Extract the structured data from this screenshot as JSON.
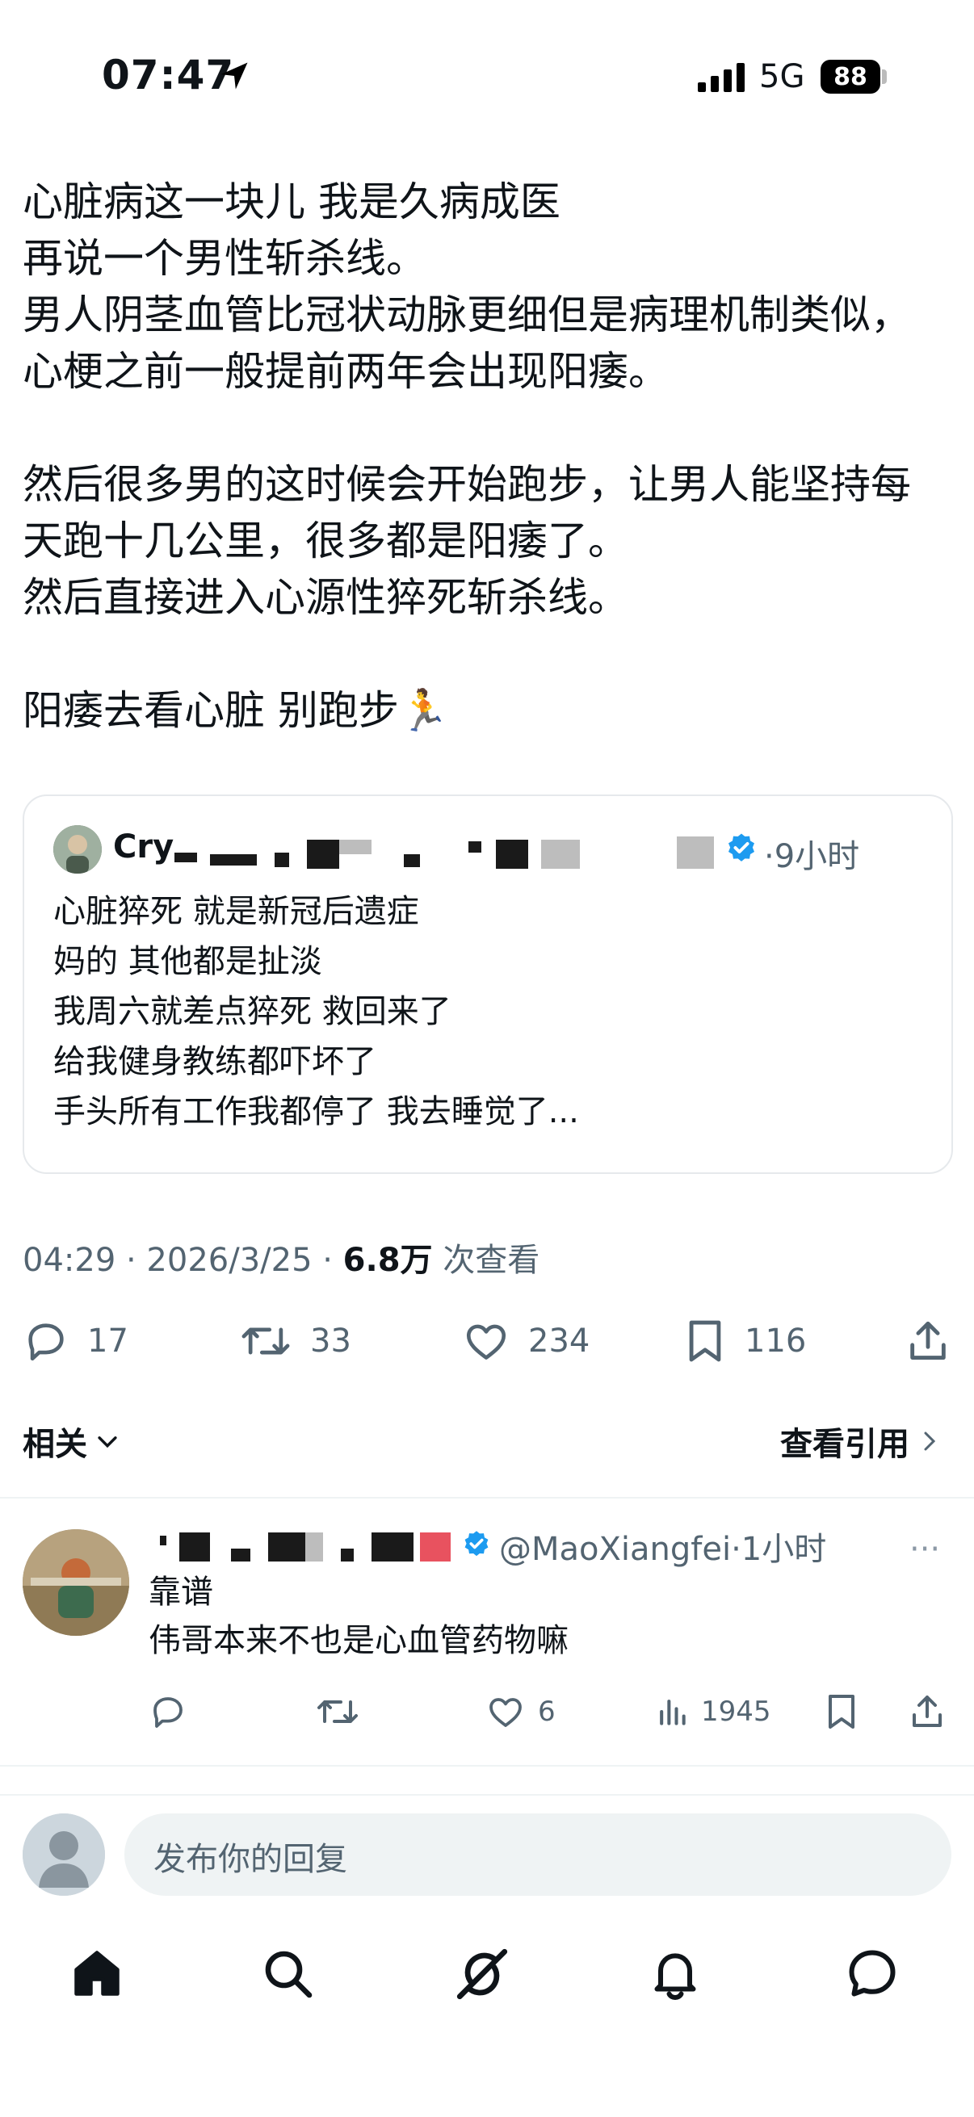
{
  "status_bar": {
    "time": "07:47",
    "network": "5G",
    "battery": "88"
  },
  "tweet": {
    "lines": [
      "心脏病这一块儿 我是久病成医",
      "再说一个男性斩杀线。",
      "男人阴茎血管比冠状动脉更细但是病理机制类似，",
      "心梗之前一般提前两年会出现阳痿。",
      "",
      "然后很多男的这时候会开始跑步，让男人能坚持每",
      "天跑十几公里，很多都是阳痿了。",
      "然后直接进入心源性猝死斩杀线。",
      "",
      "阳痿去看心脏 别跑步🏃"
    ],
    "timestamp": "04:29 · 2026/3/25 · ",
    "views_count": "6.8万",
    "views_label": " 次查看"
  },
  "quote": {
    "name_prefix": "Cry",
    "time": "·9小时",
    "lines": [
      "心脏猝死 就是新冠后遗症",
      "妈的 其他都是扯淡",
      "我周六就差点猝死 救回来了",
      "给我健身教练都吓坏了",
      "手头所有工作我都停了 我去睡觉了..."
    ]
  },
  "actions": {
    "replies": "17",
    "retweets": "33",
    "likes": "234",
    "bookmarks": "116"
  },
  "related_label": "相关",
  "view_quotes_label": "查看引用",
  "reply": {
    "handle": "@MaoXiangfei",
    "time": "·1小时",
    "more": "···",
    "lines": [
      "靠谱",
      "伟哥本来不也是心血管药物嘛"
    ],
    "likes": "6",
    "views": "1945"
  },
  "compose": {
    "placeholder": "发布你的回复"
  },
  "colors": {
    "verified": "#1d9bf0",
    "text": "#0f1419",
    "muted": "#536471"
  },
  "icons": [
    "location-arrow-icon",
    "signal-icon",
    "reply-icon",
    "retweet-icon",
    "like-icon",
    "bookmark-icon",
    "share-icon",
    "views-icon",
    "home-icon",
    "search-icon",
    "grok-icon",
    "notifications-icon",
    "messages-icon"
  ]
}
